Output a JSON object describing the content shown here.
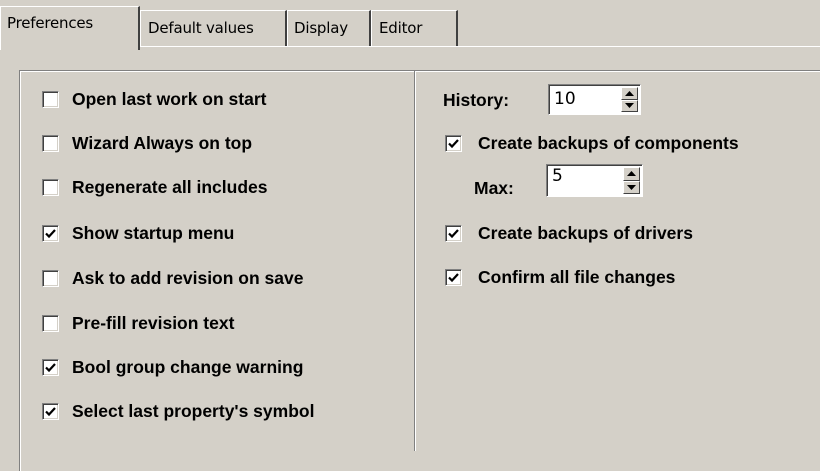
{
  "tabs": [
    {
      "label": "Preferences",
      "active": true
    },
    {
      "label": "Default values",
      "active": false
    },
    {
      "label": "Display",
      "active": false
    },
    {
      "label": "Editor",
      "active": false
    }
  ],
  "left_options": [
    {
      "label": "Open last work on start",
      "checked": false
    },
    {
      "label": "Wizard Always on top",
      "checked": false
    },
    {
      "label": "Regenerate all includes",
      "checked": false
    },
    {
      "label": "Show startup menu",
      "checked": true
    },
    {
      "label": "Ask to add revision on save",
      "checked": false
    },
    {
      "label": "Pre-fill revision text",
      "checked": false
    },
    {
      "label": "Bool group change warning",
      "checked": true
    },
    {
      "label": "Select last property's symbol",
      "checked": true
    }
  ],
  "history": {
    "label": "History:",
    "value": "10"
  },
  "backup_components": {
    "label": "Create backups of components",
    "checked": true
  },
  "max": {
    "label": "Max:",
    "value": "5"
  },
  "backup_drivers": {
    "label": "Create backups of drivers",
    "checked": true
  },
  "confirm_changes": {
    "label": "Confirm all file changes",
    "checked": true
  }
}
